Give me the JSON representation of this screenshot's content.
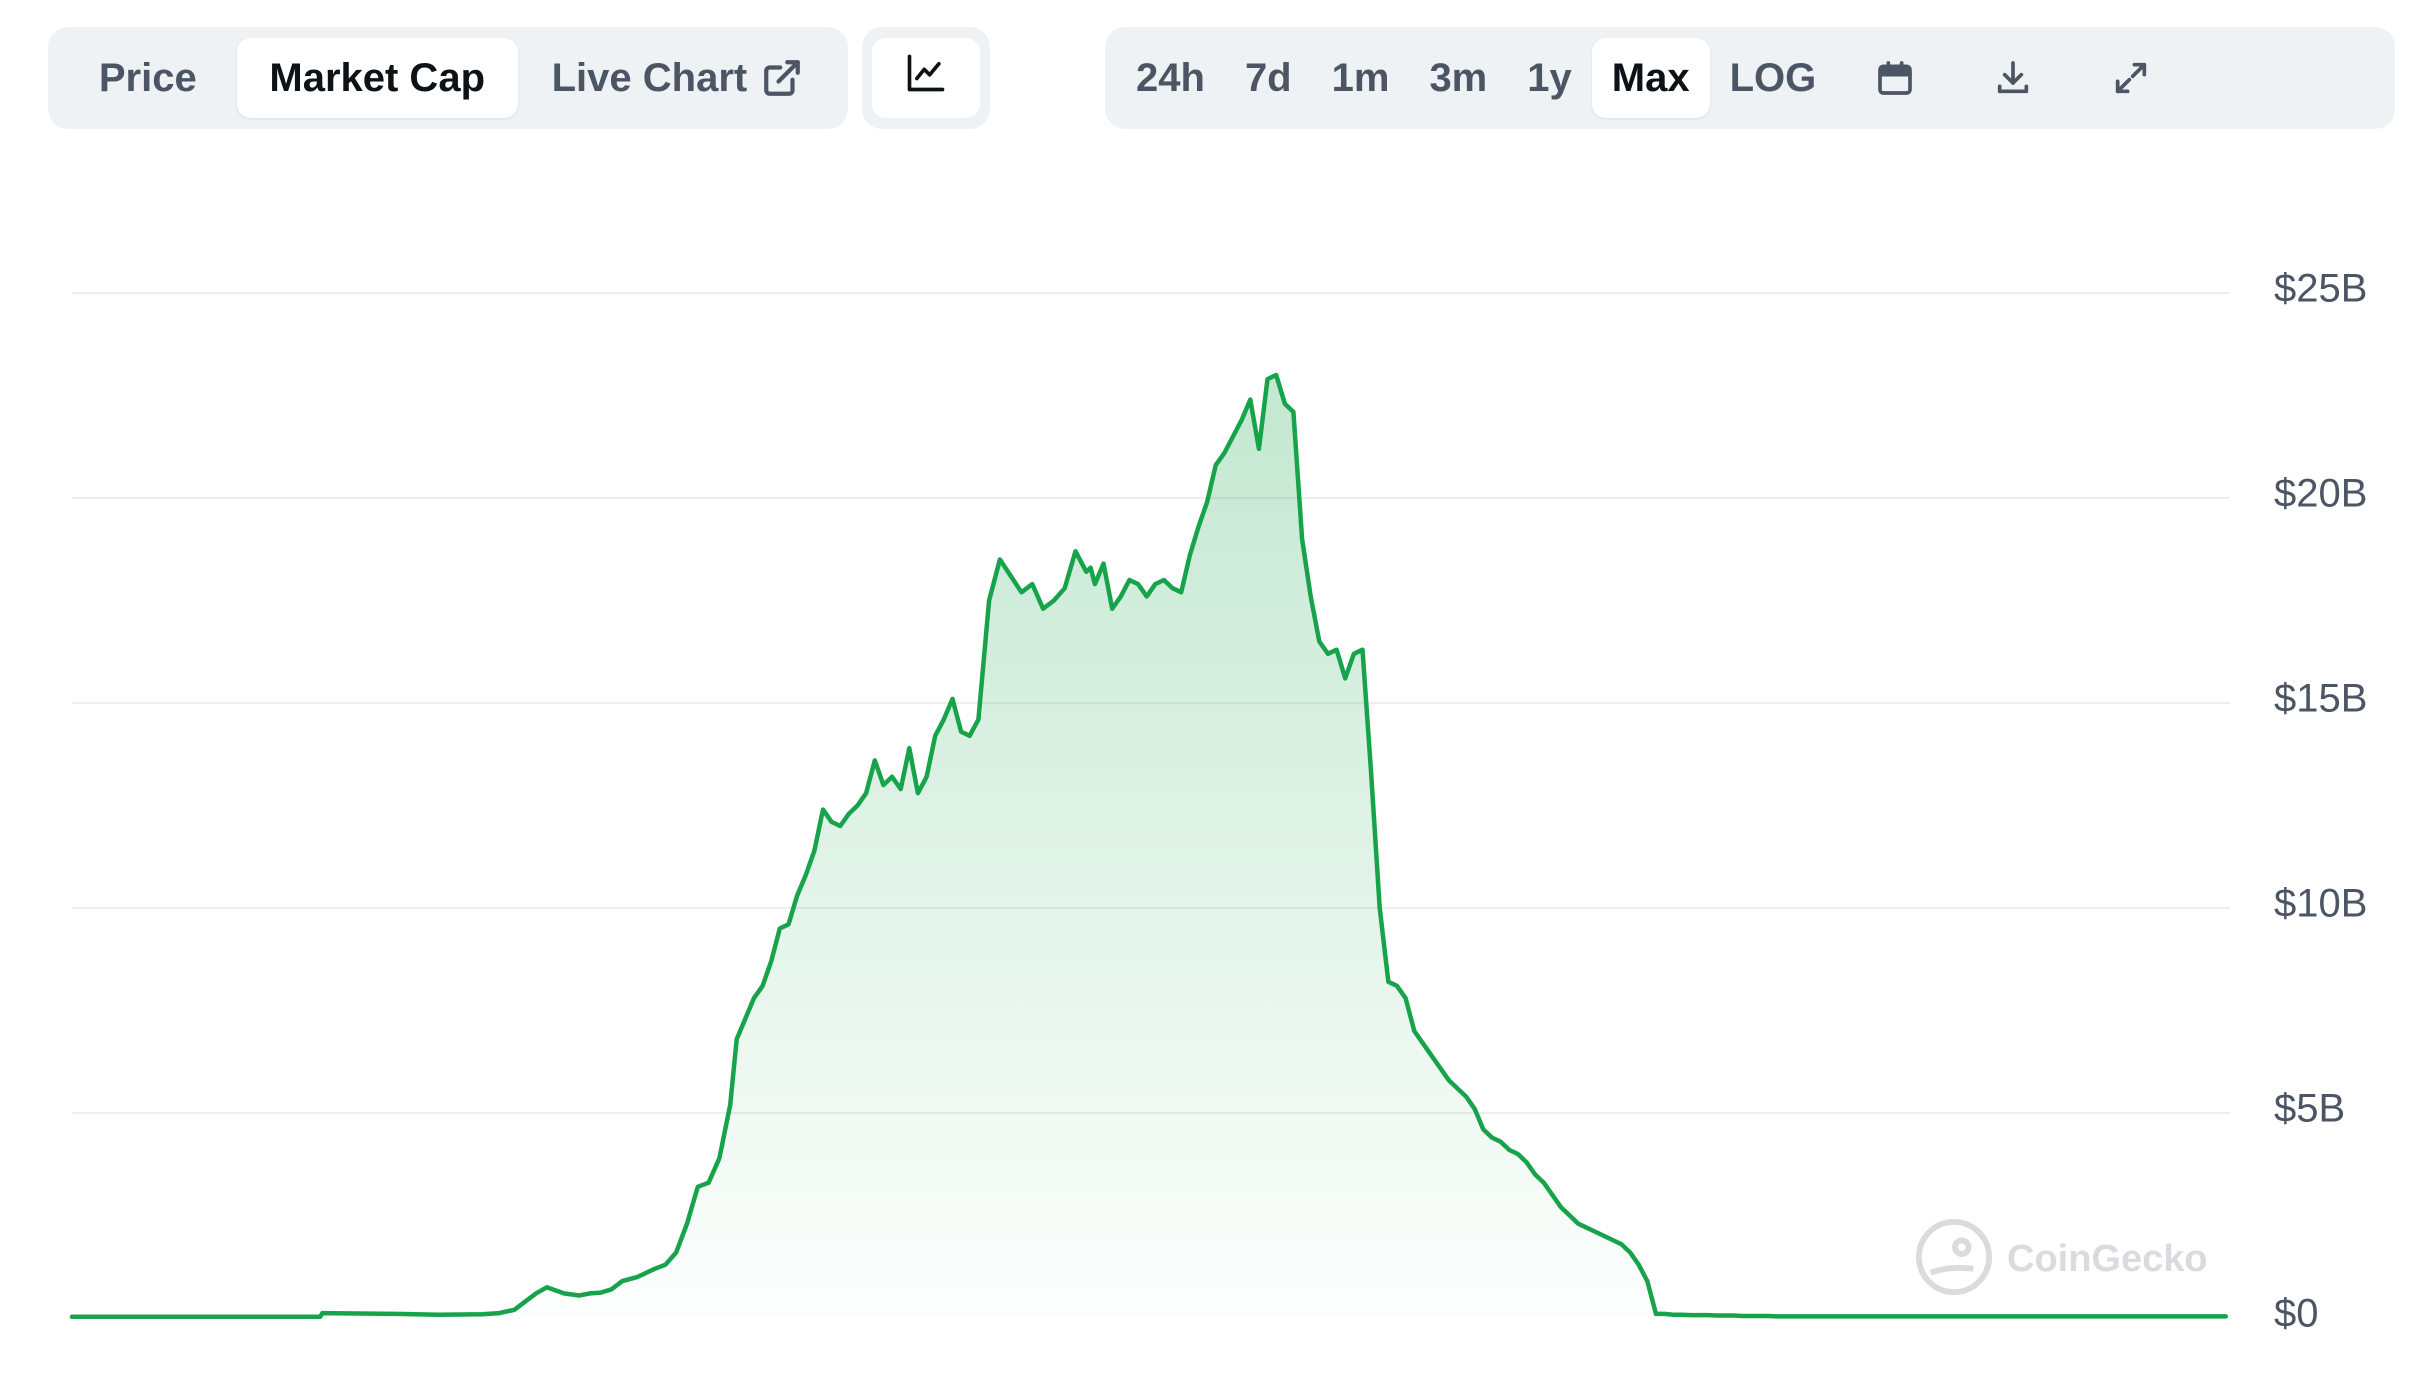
{
  "tabs": [
    {
      "label": "Price",
      "active": false
    },
    {
      "label": "Market Cap",
      "active": true
    },
    {
      "label": "Live Chart",
      "active": false
    }
  ],
  "chart_type": {
    "icon": "line-chart-icon"
  },
  "range_buttons": [
    {
      "label": "24h",
      "active": false
    },
    {
      "label": "7d",
      "active": false
    },
    {
      "label": "1m",
      "active": false
    },
    {
      "label": "3m",
      "active": false
    },
    {
      "label": "1y",
      "active": false
    },
    {
      "label": "Max",
      "active": true
    },
    {
      "label": "LOG",
      "active": false
    }
  ],
  "icons": {
    "calendar": "calendar-icon",
    "download": "download-icon",
    "fullscreen": "expand-icon",
    "external": "external-link-icon"
  },
  "watermark": "CoinGecko",
  "colors": {
    "line": "#16a34a",
    "fill_top": "#16a34a",
    "grid": "#eceef1",
    "toolbar_bg": "#eff2f5"
  },
  "chart_data": {
    "type": "area",
    "title": "",
    "xlabel": "",
    "ylabel": "",
    "ylim": [
      0,
      25
    ],
    "y_unit": "USD billions",
    "yticks": [
      "$0",
      "$5B",
      "$10B",
      "$15B",
      "$20B",
      "$25B"
    ],
    "ytick_values": [
      0,
      5,
      10,
      15,
      20,
      25
    ],
    "grid": true,
    "legend": "none",
    "x_index_range": [
      0,
      1000
    ],
    "series": [
      {
        "values_x_index": [
          0,
          115,
          116,
          150,
          170,
          190,
          198,
          205,
          210,
          215,
          220,
          228,
          235,
          240,
          245,
          250,
          255,
          262,
          270,
          275,
          280,
          285,
          290,
          295,
          300,
          305,
          308,
          312,
          316,
          320,
          324,
          328,
          332,
          336,
          340,
          344,
          348,
          352,
          356,
          360,
          364,
          368,
          372,
          376,
          380,
          384,
          388,
          392,
          396,
          400,
          404,
          408,
          412,
          416,
          420,
          425,
          430,
          435,
          440,
          445,
          450,
          455,
          460,
          465,
          470,
          472,
          474,
          478,
          482,
          486,
          490,
          494,
          498,
          502,
          506,
          510,
          514,
          518,
          522,
          526,
          530,
          534,
          538,
          542,
          546,
          550,
          554,
          558,
          562,
          566,
          570,
          574,
          578,
          582,
          586,
          590,
          594,
          598,
          602,
          606,
          610,
          614,
          618,
          622,
          626,
          630,
          634,
          638,
          642,
          646,
          650,
          654,
          658,
          662,
          664,
          666,
          670,
          674,
          678,
          682,
          686,
          690,
          694,
          698,
          702,
          706,
          710,
          714,
          718,
          722,
          726,
          730,
          734,
          738,
          742,
          746,
          750,
          754,
          758,
          762,
          766,
          770,
          774,
          778,
          782,
          786,
          790,
          794,
          798,
          802,
          806,
          810,
          814,
          818,
          822,
          826,
          830,
          834,
          838,
          842,
          846,
          850,
          854,
          858,
          862,
          866,
          870,
          874,
          878,
          880,
          882,
          886,
          890,
          894,
          898,
          902,
          906,
          910,
          914,
          918,
          922,
          926,
          930,
          934,
          938,
          942,
          946,
          950,
          954,
          958,
          962,
          966,
          970,
          974,
          978,
          982,
          986,
          990,
          994,
          998,
          1000
        ],
        "values": [
          0.03,
          0.03,
          0.12,
          0.1,
          0.08,
          0.09,
          0.12,
          0.2,
          0.4,
          0.6,
          0.75,
          0.6,
          0.55,
          0.6,
          0.62,
          0.7,
          0.9,
          1.0,
          1.2,
          1.3,
          1.6,
          2.3,
          3.2,
          3.3,
          3.9,
          5.2,
          6.8,
          7.3,
          7.8,
          8.1,
          8.7,
          9.5,
          9.6,
          10.3,
          10.8,
          11.4,
          12.4,
          12.1,
          12.0,
          12.3,
          12.5,
          12.8,
          13.6,
          13.0,
          13.2,
          12.9,
          13.9,
          12.8,
          13.2,
          14.2,
          14.6,
          15.1,
          14.3,
          14.2,
          14.6,
          17.5,
          18.5,
          18.1,
          17.7,
          17.9,
          17.3,
          17.5,
          17.8,
          18.7,
          18.2,
          18.3,
          17.9,
          18.4,
          17.3,
          17.6,
          18.0,
          17.9,
          17.6,
          17.9,
          18.0,
          17.8,
          17.7,
          18.6,
          19.3,
          19.9,
          20.8,
          21.1,
          21.5,
          21.9,
          22.4,
          21.2,
          22.9,
          23.0,
          22.3,
          22.1,
          19.0,
          17.6,
          16.5,
          16.2,
          16.3,
          15.6,
          16.2,
          16.3,
          13.3,
          10.0,
          8.2,
          8.1,
          7.8,
          7.0,
          6.7,
          6.4,
          6.1,
          5.8,
          5.6,
          5.4,
          5.1,
          4.6,
          4.4,
          4.3,
          4.2,
          4.1,
          4.0,
          3.8,
          3.5,
          3.3,
          3.0,
          2.7,
          2.5,
          2.3,
          2.2,
          2.1,
          2.0,
          1.9,
          1.8,
          1.6,
          1.3,
          0.9,
          0.1,
          0.1,
          0.08,
          0.08,
          0.07,
          0.07,
          0.07,
          0.06,
          0.06,
          0.06,
          0.05,
          0.05,
          0.05,
          0.05,
          0.04,
          0.04,
          0.04,
          0.04,
          0.04,
          0.04,
          0.04,
          0.04,
          0.04,
          0.04,
          0.04,
          0.04,
          0.04,
          0.04,
          0.04,
          0.04,
          0.04,
          0.04,
          0.04,
          0.04,
          0.04,
          0.04,
          0.04,
          0.04,
          0.04,
          0.04,
          0.04,
          0.04,
          0.04,
          0.04,
          0.04,
          0.04,
          0.04,
          0.04,
          0.04,
          0.04,
          0.04,
          0.04,
          0.04,
          0.04,
          0.04,
          0.04,
          0.04,
          0.04,
          0.04,
          0.04,
          0.04,
          0.04,
          0.04,
          0.04,
          0.04,
          0.04,
          0.04,
          0.04
        ]
      }
    ]
  }
}
